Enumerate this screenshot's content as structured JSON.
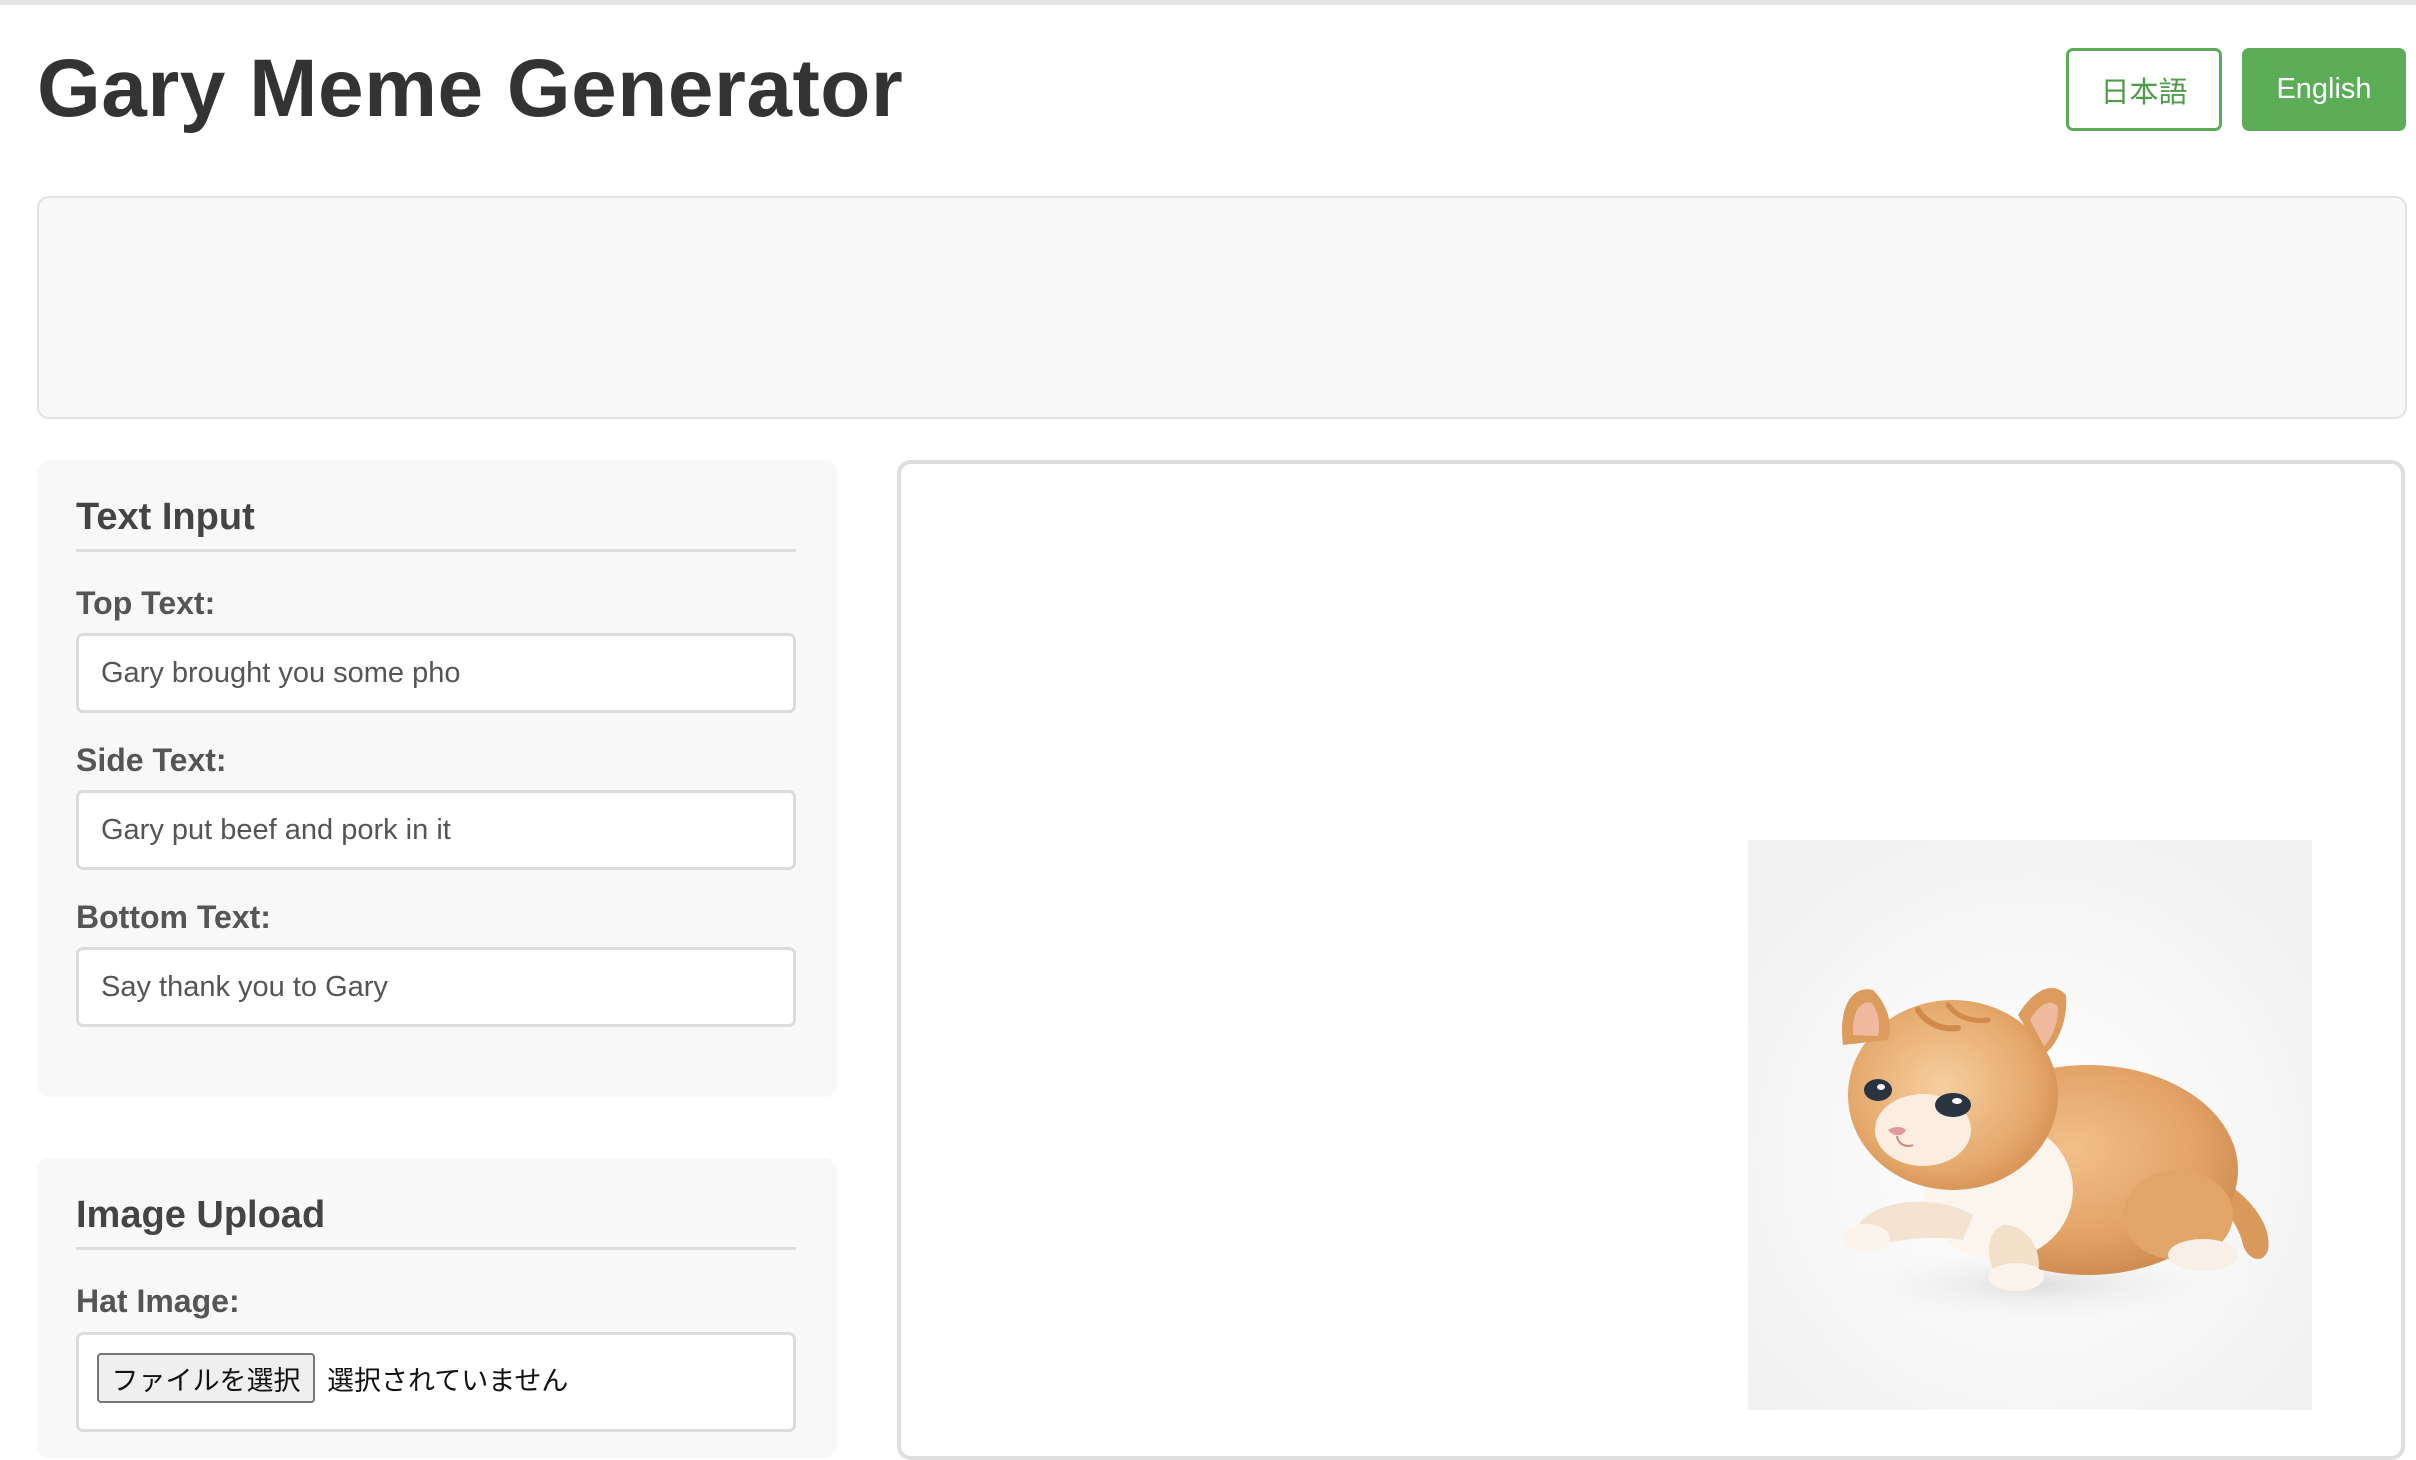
{
  "header": {
    "title": "Gary Meme Generator",
    "lang_ja_label": "日本語",
    "lang_en_label": "English"
  },
  "text_input": {
    "section_title": "Text Input",
    "top_label": "Top Text:",
    "top_value": "Gary brought you some pho",
    "side_label": "Side Text:",
    "side_value": "Gary put beef and pork in it",
    "bottom_label": "Bottom Text:",
    "bottom_value": "Say thank you to Gary"
  },
  "image_upload": {
    "section_title": "Image Upload",
    "hat_label": "Hat Image:",
    "file_button_label": "ファイルを選択",
    "file_status": "選択されていません"
  },
  "preview": {
    "image_subject": "orange-kitten"
  },
  "colors": {
    "accent_green": "#5cad58",
    "panel_bg": "#f8f8f8"
  }
}
